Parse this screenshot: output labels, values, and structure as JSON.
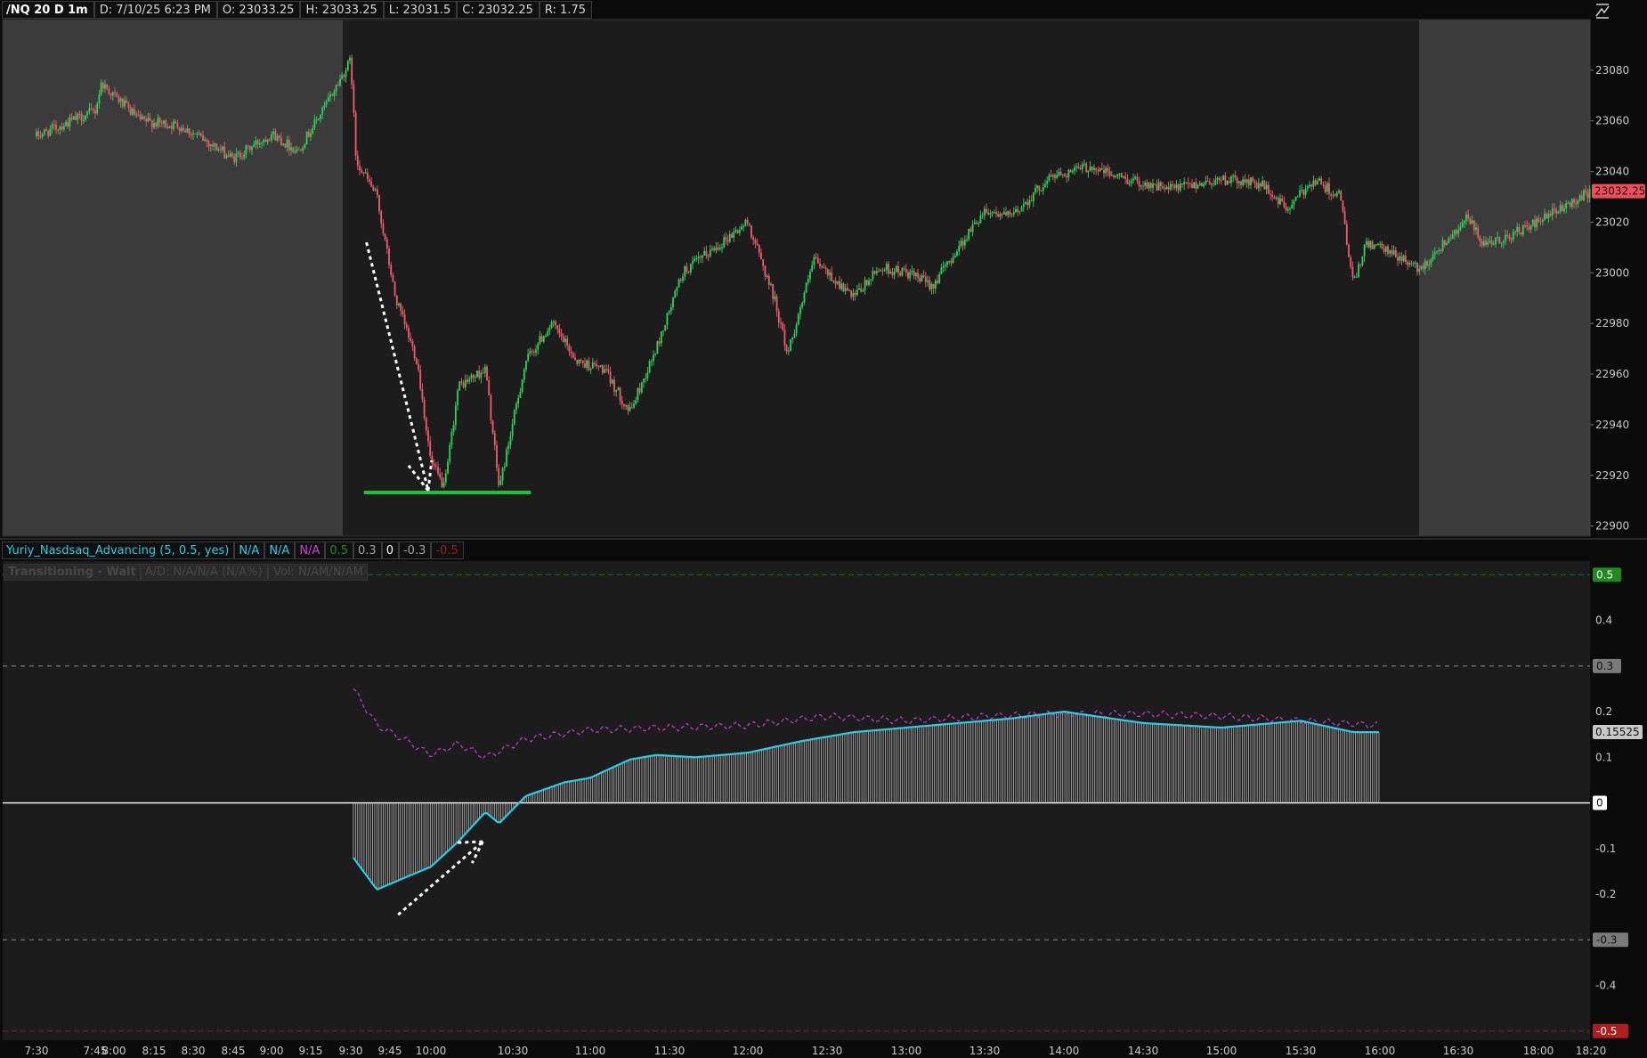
{
  "header": {
    "symbol": "/NQ 20 D 1m",
    "date": "D: 7/10/25 6:23 PM",
    "open": "O: 23033.25",
    "high": "H: 23033.25",
    "low": "L: 23031.5",
    "close": "C: 23032.25",
    "range": "R: 1.75"
  },
  "study_header": {
    "name": "Yuriy_Nasdsaq_Advancing (5, 0.5, yes)",
    "v1": "N/A",
    "v2": "N/A",
    "v3": "N/A",
    "l1": "0.5",
    "l2": "0.3",
    "l3": "0",
    "l4": "-0.3",
    "l5": "-0.5"
  },
  "status_bar": {
    "state": "Transitioning - Wait",
    "ad": "A/D: N/A/N/A (N/A%) | Vol: N/AM/N/AM"
  },
  "colors": {
    "background": "#1c1c1c",
    "extended_hours": "#3b3b3b",
    "up_candle": "#2fd35a",
    "down_candle": "#ef5d6a",
    "histogram": "#d0d0d0",
    "oscillator": "#2ecbe6",
    "signal": "#c23ac9",
    "last_price": "#ea4f5c",
    "support_line": "#18c43c",
    "annotation": "#ffffff"
  },
  "chart_data": [
    {
      "type": "candlestick",
      "title": "/NQ 20 D 1m",
      "x_ticks": [
        "7:30",
        "7:45",
        "8:00",
        "8:15",
        "8:30",
        "8:45",
        "9:00",
        "9:15",
        "9:30",
        "9:45",
        "10:00",
        "10:30",
        "11:00",
        "11:30",
        "12:00",
        "12:30",
        "13:00",
        "13:30",
        "14:00",
        "14:30",
        "15:00",
        "15:30",
        "16:00",
        "16:30",
        "18:00",
        "18:20"
      ],
      "y_ticks": [
        "23080",
        "23060",
        "23040",
        "23020",
        "23000",
        "22980",
        "22960",
        "22940",
        "22920",
        "22900"
      ],
      "ylim": [
        22896,
        23100
      ],
      "last_price": "23032.25",
      "extended_hours_shading": [
        [
          "7:30",
          "9:30"
        ],
        [
          "16:15",
          "18:20"
        ]
      ],
      "price_path_approx": [
        {
          "t": "7:30",
          "p": 23054
        },
        {
          "t": "7:45",
          "p": 23064
        },
        {
          "t": "7:50",
          "p": 23075
        },
        {
          "t": "8:00",
          "p": 23070
        },
        {
          "t": "8:10",
          "p": 23060
        },
        {
          "t": "8:25",
          "p": 23058
        },
        {
          "t": "8:35",
          "p": 23052
        },
        {
          "t": "8:45",
          "p": 23045
        },
        {
          "t": "9:00",
          "p": 23055
        },
        {
          "t": "9:10",
          "p": 23048
        },
        {
          "t": "9:20",
          "p": 23065
        },
        {
          "t": "9:30",
          "p": 23084
        },
        {
          "t": "9:32",
          "p": 23045
        },
        {
          "t": "9:40",
          "p": 23030
        },
        {
          "t": "9:47",
          "p": 22990
        },
        {
          "t": "9:55",
          "p": 22965
        },
        {
          "t": "10:00",
          "p": 22925
        },
        {
          "t": "10:05",
          "p": 22915
        },
        {
          "t": "10:10",
          "p": 22955
        },
        {
          "t": "10:20",
          "p": 22962
        },
        {
          "t": "10:25",
          "p": 22915
        },
        {
          "t": "10:35",
          "p": 22965
        },
        {
          "t": "10:45",
          "p": 22980
        },
        {
          "t": "10:55",
          "p": 22965
        },
        {
          "t": "11:05",
          "p": 22962
        },
        {
          "t": "11:15",
          "p": 22945
        },
        {
          "t": "11:25",
          "p": 22970
        },
        {
          "t": "11:35",
          "p": 23000
        },
        {
          "t": "11:50",
          "p": 23012
        },
        {
          "t": "12:00",
          "p": 23020
        },
        {
          "t": "12:10",
          "p": 22990
        },
        {
          "t": "12:15",
          "p": 22968
        },
        {
          "t": "12:25",
          "p": 23005
        },
        {
          "t": "12:40",
          "p": 22990
        },
        {
          "t": "12:50",
          "p": 23002
        },
        {
          "t": "13:00",
          "p": 23000
        },
        {
          "t": "13:10",
          "p": 22995
        },
        {
          "t": "13:30",
          "p": 23025
        },
        {
          "t": "13:40",
          "p": 23022
        },
        {
          "t": "13:55",
          "p": 23038
        },
        {
          "t": "14:10",
          "p": 23042
        },
        {
          "t": "14:20",
          "p": 23038
        },
        {
          "t": "14:40",
          "p": 23033
        },
        {
          "t": "15:00",
          "p": 23037
        },
        {
          "t": "15:15",
          "p": 23035
        },
        {
          "t": "15:25",
          "p": 23025
        },
        {
          "t": "15:35",
          "p": 23037
        },
        {
          "t": "15:45",
          "p": 23030
        },
        {
          "t": "15:50",
          "p": 22995
        },
        {
          "t": "15:55",
          "p": 23012
        },
        {
          "t": "16:10",
          "p": 23005
        },
        {
          "t": "16:15",
          "p": 23001
        },
        {
          "t": "16:40",
          "p": 23022
        },
        {
          "t": "17:00",
          "p": 23010
        },
        {
          "t": "18:00",
          "p": 23020
        },
        {
          "t": "18:20",
          "p": 23032.25
        }
      ]
    },
    {
      "type": "line",
      "title": "Yuriy_Nasdsaq_Advancing (5, 0.5, yes)",
      "y_ticks": [
        "0.5",
        "0.4",
        "0.3",
        "0.2",
        "0.1",
        "0",
        "-0.1",
        "-0.2",
        "-0.3",
        "-0.4",
        "-0.5"
      ],
      "ylim": [
        -0.52,
        0.53
      ],
      "levels": [
        0.5,
        0.3,
        0,
        -0.3,
        -0.5
      ],
      "last_value": "0.15525",
      "series": [
        {
          "values_approx": [
            {
              "t": "9:31",
              "v": -0.12
            },
            {
              "t": "9:40",
              "v": -0.19
            },
            {
              "t": "9:50",
              "v": -0.165
            },
            {
              "t": "10:00",
              "v": -0.14
            },
            {
              "t": "10:10",
              "v": -0.085
            },
            {
              "t": "10:20",
              "v": -0.02
            },
            {
              "t": "10:25",
              "v": -0.045
            },
            {
              "t": "10:35",
              "v": 0.015
            },
            {
              "t": "10:50",
              "v": 0.045
            },
            {
              "t": "11:00",
              "v": 0.055
            },
            {
              "t": "11:15",
              "v": 0.095
            },
            {
              "t": "11:25",
              "v": 0.105
            },
            {
              "t": "11:40",
              "v": 0.1
            },
            {
              "t": "12:00",
              "v": 0.11
            },
            {
              "t": "12:20",
              "v": 0.135
            },
            {
              "t": "12:40",
              "v": 0.155
            },
            {
              "t": "13:10",
              "v": 0.17
            },
            {
              "t": "13:40",
              "v": 0.185
            },
            {
              "t": "14:00",
              "v": 0.2
            },
            {
              "t": "14:30",
              "v": 0.175
            },
            {
              "t": "15:00",
              "v": 0.165
            },
            {
              "t": "15:30",
              "v": 0.18
            },
            {
              "t": "15:50",
              "v": 0.155
            },
            {
              "t": "16:00",
              "v": 0.155
            }
          ]
        },
        {
          "values_approx": [
            {
              "t": "9:31",
              "v": 0.25
            },
            {
              "t": "9:40",
              "v": 0.17
            },
            {
              "t": "9:50",
              "v": 0.14
            },
            {
              "t": "10:00",
              "v": 0.105
            },
            {
              "t": "10:10",
              "v": 0.13
            },
            {
              "t": "10:20",
              "v": 0.1
            },
            {
              "t": "10:35",
              "v": 0.14
            },
            {
              "t": "11:00",
              "v": 0.16
            },
            {
              "t": "11:30",
              "v": 0.165
            },
            {
              "t": "12:00",
              "v": 0.17
            },
            {
              "t": "12:30",
              "v": 0.19
            },
            {
              "t": "13:00",
              "v": 0.18
            },
            {
              "t": "13:30",
              "v": 0.19
            },
            {
              "t": "14:00",
              "v": 0.195
            },
            {
              "t": "14:30",
              "v": 0.195
            },
            {
              "t": "15:00",
              "v": 0.19
            },
            {
              "t": "15:30",
              "v": 0.18
            },
            {
              "t": "16:00",
              "v": 0.17
            }
          ]
        }
      ]
    }
  ]
}
